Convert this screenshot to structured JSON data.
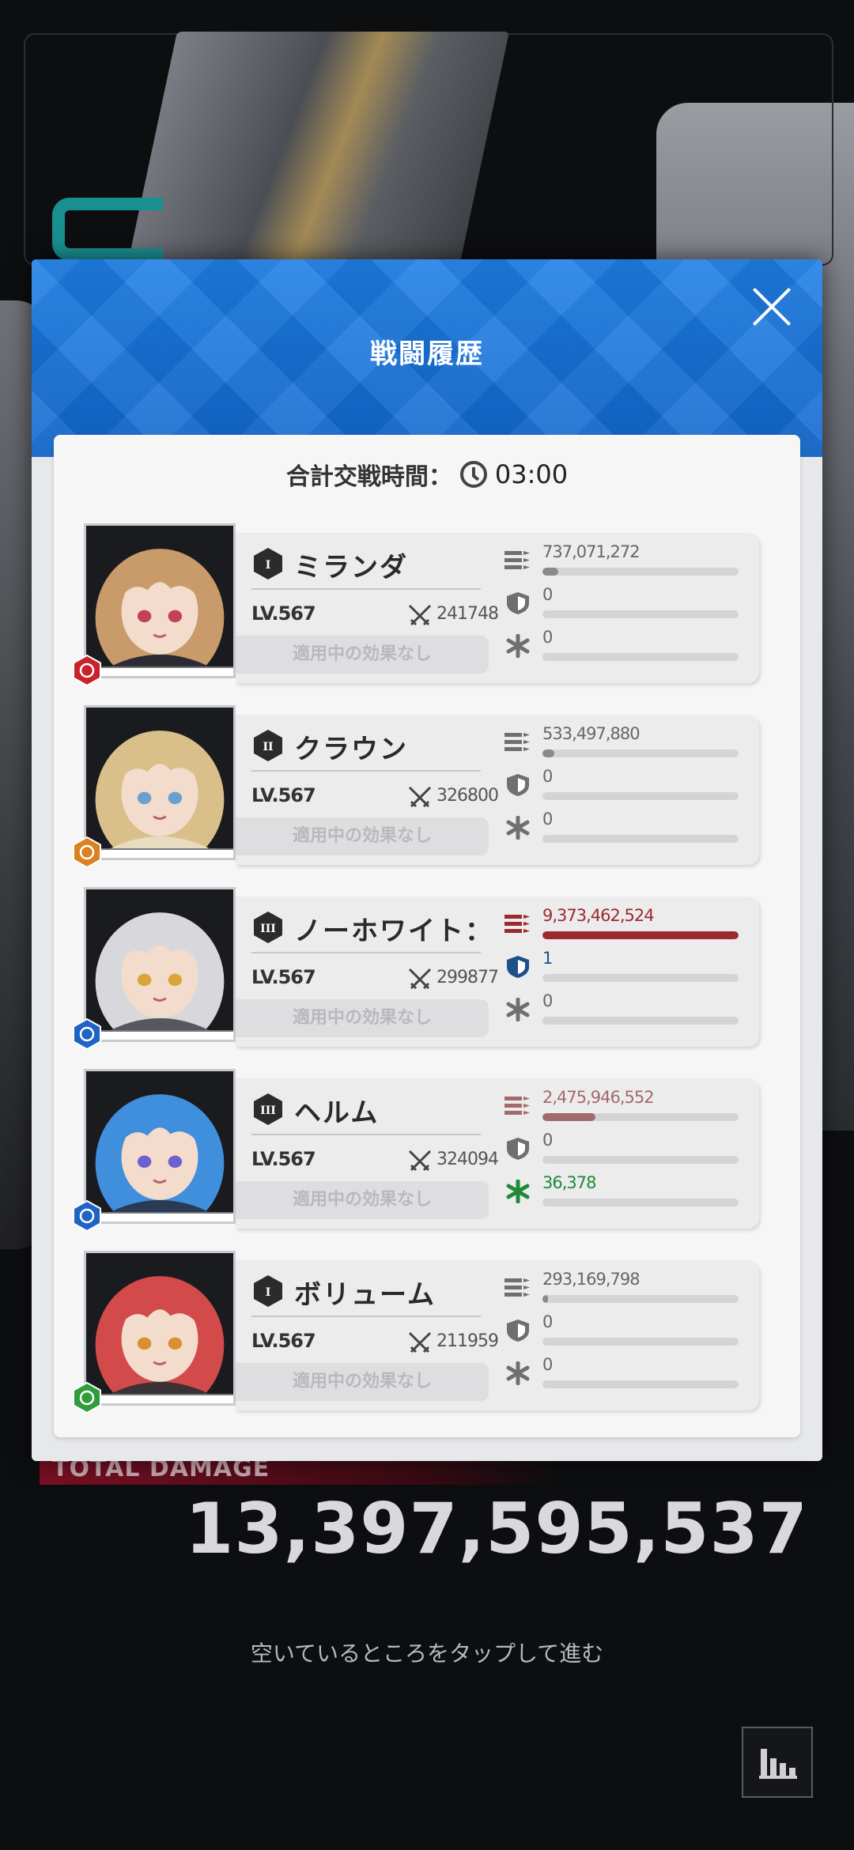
{
  "modal": {
    "title": "戦闘履歴",
    "battle_time_label": "合計交戦時間：",
    "battle_time_value": "03:00"
  },
  "units": [
    {
      "burst": "I",
      "name": "ミランダ",
      "level": "LV.567",
      "power": "241748",
      "effect": "適用中の効果なし",
      "element": "fire",
      "element_color": "#c8232b",
      "damage": "737,071,272",
      "damage_fraction": 0.08,
      "shield": "0",
      "shield_fraction": 0,
      "heal": "0",
      "heal_fraction": 0,
      "damage_color": "#8a8a8c",
      "highlight": "none",
      "hair": "#c99a6a",
      "outfit": "#2a2b33",
      "eyes": "#c2405a"
    },
    {
      "burst": "II",
      "name": "クラウン",
      "level": "LV.567",
      "power": "326800",
      "effect": "適用中の効果なし",
      "element": "iron",
      "element_color": "#d9821f",
      "damage": "533,497,880",
      "damage_fraction": 0.06,
      "shield": "0",
      "shield_fraction": 0,
      "heal": "0",
      "heal_fraction": 0,
      "damage_color": "#8a8a8c",
      "highlight": "none",
      "hair": "#d9c08a",
      "outfit": "#e8dcc0",
      "eyes": "#6aa0d0"
    },
    {
      "burst": "III",
      "name": "ノーホワイト：",
      "level": "LV.567",
      "power": "299877",
      "effect": "適用中の効果なし",
      "element": "water",
      "element_color": "#1f63c4",
      "damage": "9,373,462,524",
      "damage_fraction": 1.0,
      "shield": "1",
      "shield_fraction": 0,
      "heal": "0",
      "heal_fraction": 0,
      "damage_color": "#9b2a2e",
      "highlight": "damage-shield",
      "hair": "#d8d8dc",
      "outfit": "#55585f",
      "eyes": "#d8a53a"
    },
    {
      "burst": "III",
      "name": "ヘルム",
      "level": "LV.567",
      "power": "324094",
      "effect": "適用中の効果なし",
      "element": "water",
      "element_color": "#1f63c4",
      "damage": "2,475,946,552",
      "damage_fraction": 0.27,
      "shield": "0",
      "shield_fraction": 0,
      "heal": "36,378",
      "heal_fraction": 0,
      "damage_color": "#a36a6c",
      "highlight": "damage-heal",
      "hair": "#3f8fdc",
      "outfit": "#2a3a55",
      "eyes": "#6f5fd0"
    },
    {
      "burst": "I",
      "name": "ボリューム",
      "level": "LV.567",
      "power": "211959",
      "effect": "適用中の効果なし",
      "element": "wind",
      "element_color": "#2f9d3c",
      "damage": "293,169,798",
      "damage_fraction": 0.03,
      "shield": "0",
      "shield_fraction": 0,
      "heal": "0",
      "heal_fraction": 0,
      "damage_color": "#8a8a8c",
      "highlight": "none",
      "hair": "#d24a4a",
      "outfit": "#3a3236",
      "eyes": "#d89030"
    }
  ],
  "total": {
    "label": "TOTAL DAMAGE",
    "value": "13,397,595,537"
  },
  "hint": "空いているところをタップして進む",
  "icons": {
    "close": "close-icon",
    "clock": "clock-icon",
    "stats": "bar-chart-icon",
    "damage": "bullets-icon",
    "shield": "shield-icon",
    "heal": "heal-icon",
    "power": "crossed-swords-icon"
  }
}
